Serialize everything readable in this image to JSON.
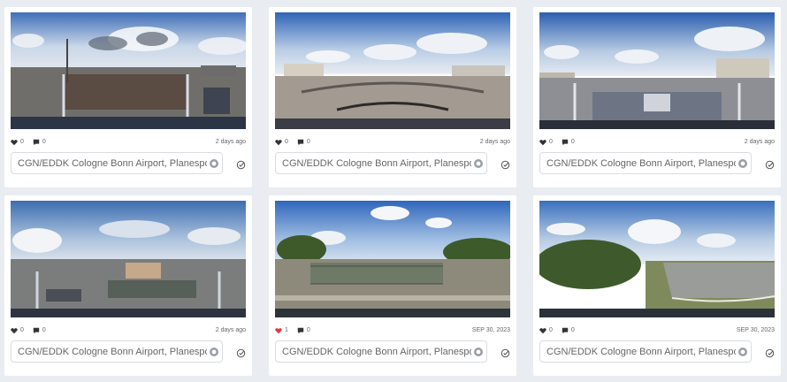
{
  "cards": [
    {
      "likes": "0",
      "comments": "0",
      "time": "2 days ago",
      "title": "CGN/EDDK Cologne Bonn Airport, Planespotting",
      "liked": false,
      "scene": "parking"
    },
    {
      "likes": "0",
      "comments": "0",
      "time": "2 days ago",
      "title": "CGN/EDDK Cologne Bonn Airport, Planespotting",
      "liked": false,
      "scene": "terrace"
    },
    {
      "likes": "0",
      "comments": "0",
      "time": "2 days ago",
      "title": "CGN/EDDK Cologne Bonn Airport, Planespotting",
      "liked": false,
      "scene": "deck"
    },
    {
      "likes": "0",
      "comments": "0",
      "time": "2 days ago",
      "title": "CGN/EDDK Cologne Bonn Airport, Planespotting",
      "liked": false,
      "scene": "highway"
    },
    {
      "likes": "1",
      "comments": "0",
      "time": "SEP 30, 2023",
      "title": "CGN/EDDK Cologne Bonn Airport, Planespotting",
      "liked": true,
      "scene": "fence"
    },
    {
      "likes": "0",
      "comments": "0",
      "time": "SEP 30, 2023",
      "title": "CGN/EDDK Cologne Bonn Airport, Planespotting",
      "liked": false,
      "scene": "road"
    }
  ],
  "colors": {
    "liked": "#e0393e",
    "icon": "#333333",
    "check": "#555555"
  },
  "icons": {
    "like": "heart-icon",
    "comment": "comment-icon",
    "tag": "tag-icon",
    "select": "check-circle-icon"
  }
}
